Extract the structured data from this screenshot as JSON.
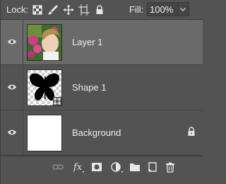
{
  "toolbar": {
    "lock_label": "Lock:",
    "lock_icons": [
      "lock-transparent-pixels-icon",
      "lock-image-pixels-icon",
      "lock-position-icon",
      "lock-artboard-icon",
      "lock-all-icon"
    ],
    "fill_label": "Fill:",
    "fill_value": "100%"
  },
  "layers": [
    {
      "name": "Layer 1",
      "visible": true,
      "selected": true,
      "thumbnail": "photo-girl-flowers"
    },
    {
      "name": "Shape 1",
      "visible": true,
      "selected": false,
      "thumbnail": "butterfly-shape"
    },
    {
      "name": "Background",
      "visible": true,
      "selected": false,
      "locked": true,
      "thumbnail": "white-fill"
    }
  ],
  "bottom_icons": [
    "link-layers-icon",
    "fx-icon",
    "add-mask-icon",
    "adjustment-layer-icon",
    "new-group-icon",
    "new-layer-icon",
    "delete-layer-icon"
  ],
  "colors": {
    "panel": "#535353",
    "selected_row": "#6a6a6a"
  }
}
